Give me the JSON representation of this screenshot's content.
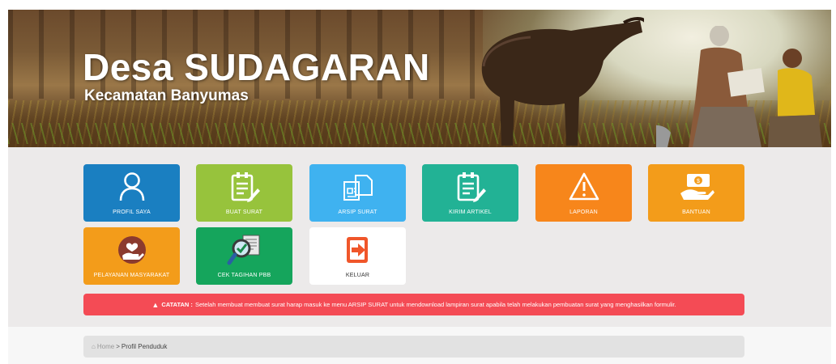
{
  "header": {
    "title": "Desa SUDAGARAN",
    "subtitle": "Kecamatan Banyumas"
  },
  "menu": [
    {
      "label": "PROFIL SAYA",
      "icon": "user-icon",
      "color": "#1a7fc1"
    },
    {
      "label": "BUAT SURAT",
      "icon": "document-edit-icon",
      "color": "#97c33c"
    },
    {
      "label": "ARSIP SURAT",
      "icon": "files-icon",
      "color": "#3fb2f0"
    },
    {
      "label": "KIRIM ARTIKEL",
      "icon": "article-edit-icon",
      "color": "#22b295"
    },
    {
      "label": "LAPORAN",
      "icon": "warning-icon",
      "color": "#f7861b"
    },
    {
      "label": "BANTUAN",
      "icon": "money-hand-icon",
      "color": "#f39c1a"
    },
    {
      "label": "PELAYANAN MASYARAKAT",
      "icon": "heart-hand-icon",
      "color": "#f39c1a"
    },
    {
      "label": "CEK TAGIHAN PBB",
      "icon": "magnifier-check-icon",
      "color": "#15a55c"
    },
    {
      "label": "KELUAR",
      "icon": "logout-icon",
      "color": "#ffffff"
    }
  ],
  "notice": {
    "icon": "warning-triangle-icon",
    "label": "CATATAN :",
    "text": "Setelah membuat membuat surat harap masuk ke menu ARSIP SURAT untuk mendownload lampiran surat apabila telah melakukan pembuatan surat yang menghasilkan formulir.",
    "color": "#f44b55"
  },
  "breadcrumb": {
    "home_icon": "home-icon",
    "home": "Home",
    "separator": ">",
    "current": "Profil Penduduk"
  }
}
